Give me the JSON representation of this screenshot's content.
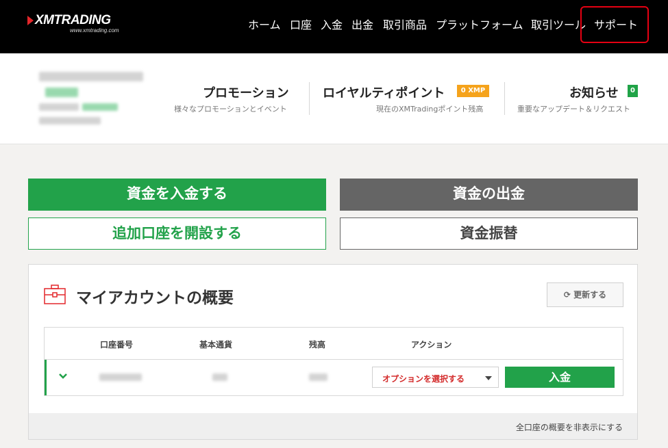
{
  "brand": {
    "name": "XMTRADING",
    "url": "www.xmtrading.com",
    "accent": "#e3262a"
  },
  "nav": {
    "items": [
      {
        "label": "ホーム"
      },
      {
        "label": "口座"
      },
      {
        "label": "入金"
      },
      {
        "label": "出金"
      },
      {
        "label": "取引商品"
      },
      {
        "label": "プラットフォーム"
      },
      {
        "label": "取引ツール"
      },
      {
        "label": "サポート"
      }
    ],
    "highlight_color": "#e60012"
  },
  "info": {
    "promotion": {
      "title": "プロモーション",
      "sub": "様々なプロモーションとイベント"
    },
    "loyalty": {
      "title": "ロイヤルティポイント",
      "badge": "0 XMP",
      "sub": "現在のXMTradingポイント残高"
    },
    "news": {
      "title": "お知らせ",
      "badge": "0",
      "sub": "重要なアップデート＆リクエスト"
    }
  },
  "actions": {
    "deposit": "資金を入金する",
    "withdraw": "資金の出金",
    "open_account": "追加口座を開設する",
    "transfer": "資金振替"
  },
  "account_panel": {
    "title": "マイアカウントの概要",
    "refresh": "更新する",
    "columns": [
      "口座番号",
      "基本通貨",
      "残高",
      "アクション"
    ],
    "option_select": "オプションを選択する",
    "deposit_button": "入金",
    "hide_link": "全口座の概要を非表示にする"
  },
  "colors": {
    "green": "#22a24a",
    "dark_gray": "#656565",
    "badge_orange": "#f5a31c",
    "option_red": "#d32a2a"
  }
}
